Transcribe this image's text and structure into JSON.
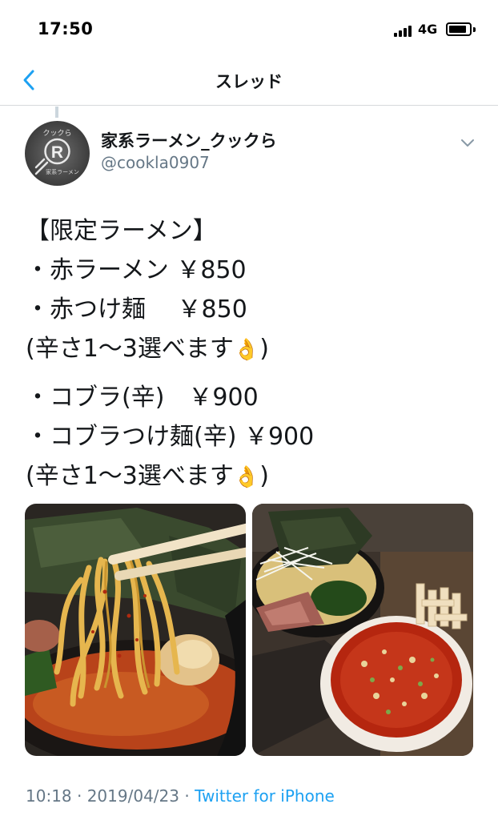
{
  "status_bar": {
    "time": "17:50",
    "network": "4G"
  },
  "nav": {
    "title": "スレッド",
    "back_icon": "chevron-left-icon"
  },
  "tweet": {
    "display_name": "家系ラーメン_クックら",
    "handle": "@cookla0907",
    "avatar_text": {
      "top": "クックら",
      "bottom": "家系ラーメン",
      "center": "R"
    },
    "lines": [
      "【限定ラーメン】",
      "・赤ラーメン ￥850",
      "・赤つけ麺　 ￥850",
      "(辛さ1〜3選べます",
      "・コブラ(辛)　￥900",
      "・コブラつけ麺(辛)  ￥900",
      "(辛さ1〜3選べます"
    ],
    "emoji": "👌",
    "closing": ")",
    "timestamp": "10:18 · 2019/04/23 · ",
    "source": "Twitter for iPhone"
  },
  "colors": {
    "accent": "#1da1f2",
    "secondary_text": "#657786",
    "divider": "#d6d9dc"
  }
}
